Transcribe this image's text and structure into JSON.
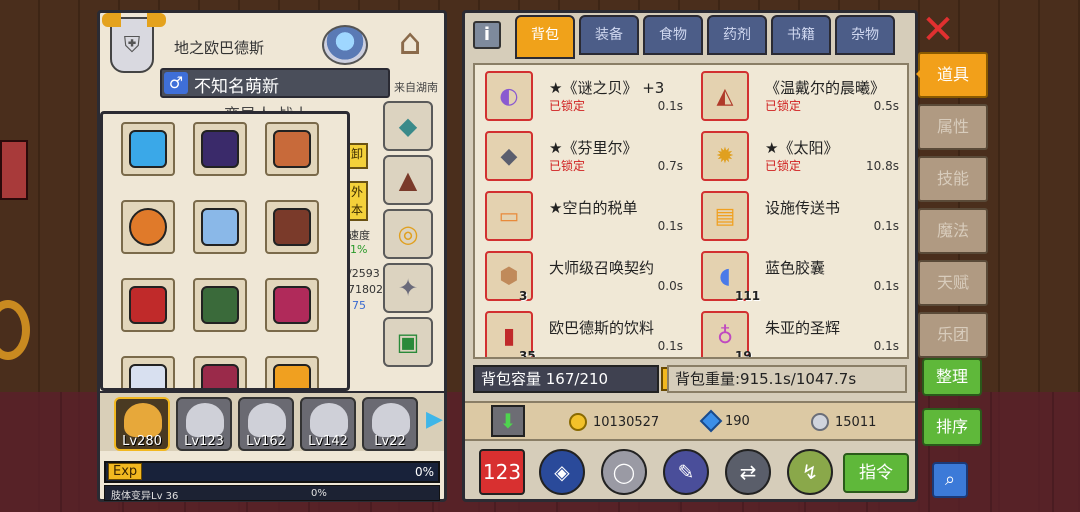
{
  "character": {
    "region": "地之欧巴德斯",
    "name": "不知名萌新",
    "origin": "来自湖南",
    "subtitle": "变异人 战士",
    "side_tags": [
      "卸",
      "外\n本"
    ],
    "side_stats": [
      "速度",
      "1%",
      "/2593",
      "71802",
      "75"
    ]
  },
  "party": [
    {
      "lv": "Lv280",
      "active": true
    },
    {
      "lv": "Lv123",
      "active": false
    },
    {
      "lv": "Lv162",
      "active": false
    },
    {
      "lv": "Lv142",
      "active": false
    },
    {
      "lv": "Lv22",
      "active": false
    }
  ],
  "exp": {
    "label": "Exp",
    "percent": "0%"
  },
  "mutation": {
    "label": "肢体变异Lv 36",
    "percent": "0%"
  },
  "inventory": {
    "info_label": "i",
    "tabs": [
      "背包",
      "装备",
      "食物",
      "药剂",
      "书籍",
      "杂物"
    ],
    "active_tab": 0,
    "items": [
      {
        "name": "★《谜之贝》 +3",
        "lock": "已锁定",
        "weight": "0.1s",
        "count": "",
        "icon": "shell-icon",
        "color": "#8a5ad0"
      },
      {
        "name": "《温戴尔的晨曦》",
        "lock": "已锁定",
        "weight": "0.5s",
        "count": "",
        "icon": "armor-icon",
        "color": "#b03a2a"
      },
      {
        "name": "★《芬里尔》",
        "lock": "已锁定",
        "weight": "0.7s",
        "count": "",
        "icon": "wolf-icon",
        "color": "#5a5e6e"
      },
      {
        "name": "★《太阳》",
        "lock": "已锁定",
        "weight": "10.8s",
        "count": "",
        "icon": "sun-mask-icon",
        "color": "#e0a020"
      },
      {
        "name": "★空白的税单",
        "lock": "",
        "weight": "0.1s",
        "count": "",
        "icon": "tax-form-icon",
        "color": "#e88a3a"
      },
      {
        "name": "设施传送书",
        "lock": "",
        "weight": "0.1s",
        "count": "",
        "icon": "teleport-book-icon",
        "color": "#f0a020"
      },
      {
        "name": "大师级召唤契约",
        "lock": "",
        "weight": "0.0s",
        "count": "3",
        "icon": "contract-icon",
        "color": "#c08a5a"
      },
      {
        "name": "蓝色胶囊",
        "lock": "",
        "weight": "0.1s",
        "count": "111",
        "icon": "capsule-icon",
        "color": "#4a7ae8"
      },
      {
        "name": "欧巴德斯的饮料",
        "lock": "",
        "weight": "0.1s",
        "count": "35",
        "icon": "drink-icon",
        "color": "#c02a2a"
      },
      {
        "name": "朱亚的圣辉",
        "lock": "",
        "weight": "0.1s",
        "count": "19",
        "icon": "potion-icon",
        "color": "#c04ac0"
      }
    ],
    "capacity": "背包容量 167/210",
    "capacity_plus": "+",
    "weight": "背包重量:915.1s/1047.7s"
  },
  "currency": {
    "gold": "10130527",
    "gems": "190",
    "silver": "15011"
  },
  "command_label": "指令",
  "side_menu": [
    "道具",
    "属性",
    "技能",
    "魔法",
    "天赋",
    "乐团"
  ],
  "side_menu_active": 0,
  "sort_label": "整理",
  "order_label": "排序",
  "close_label": "✕",
  "search_label": "⌕"
}
